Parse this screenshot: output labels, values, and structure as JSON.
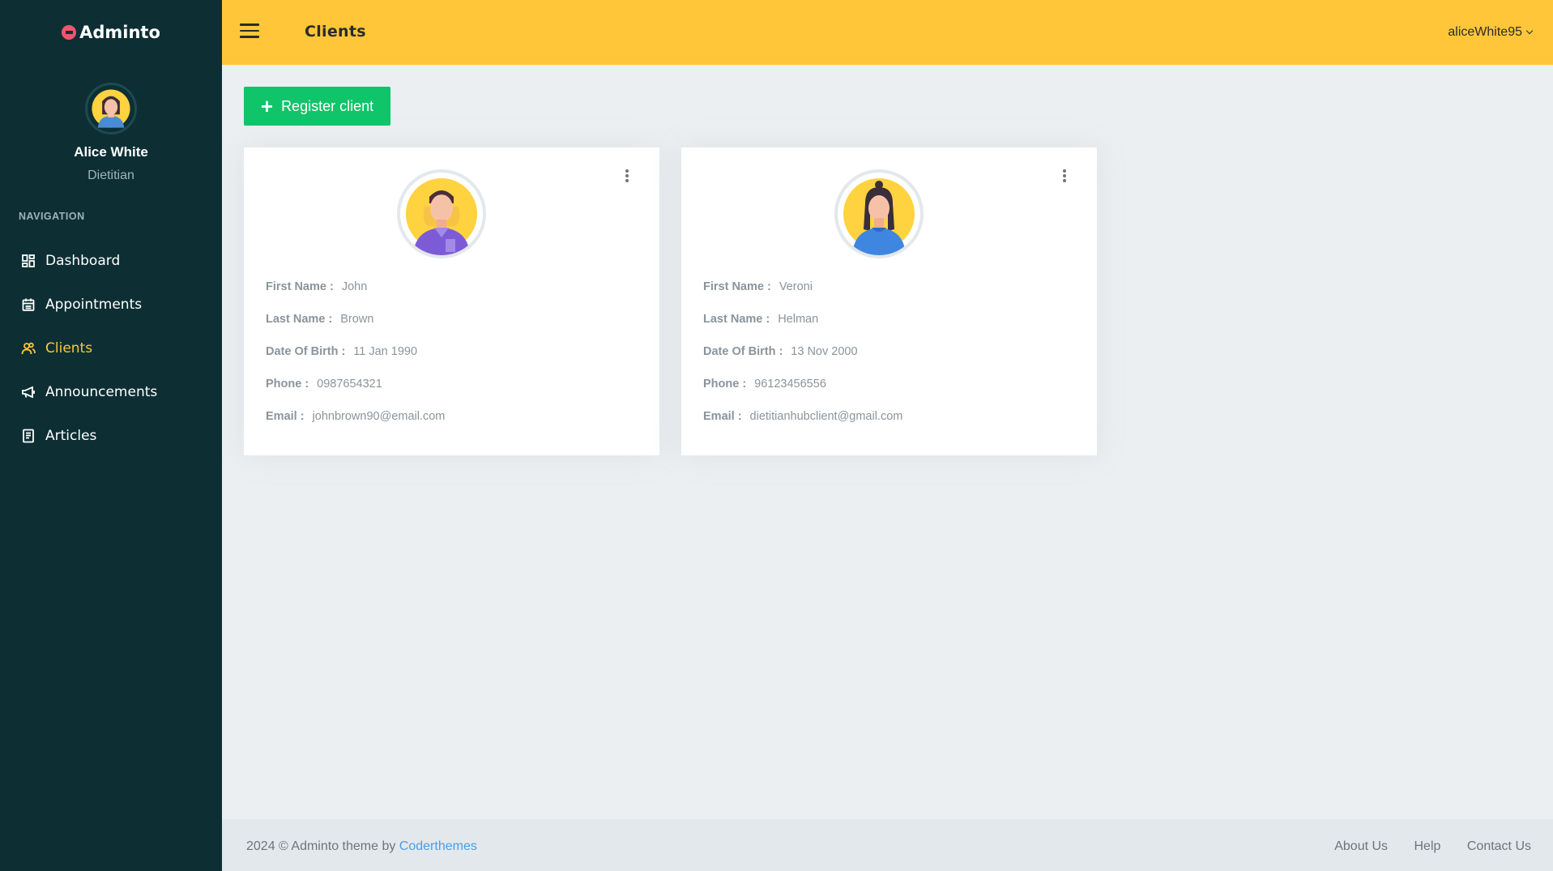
{
  "brand": {
    "name": "Adminto"
  },
  "profile": {
    "name": "Alice White",
    "role": "Dietitian"
  },
  "sidebar": {
    "heading": "NAVIGATION",
    "items": [
      {
        "label": "Dashboard",
        "icon": "dashboard-icon"
      },
      {
        "label": "Appointments",
        "icon": "calendar-icon"
      },
      {
        "label": "Clients",
        "icon": "users-icon",
        "active": true
      },
      {
        "label": "Announcements",
        "icon": "megaphone-icon"
      },
      {
        "label": "Articles",
        "icon": "article-icon"
      }
    ]
  },
  "topbar": {
    "title": "Clients",
    "username": "aliceWhite95"
  },
  "actions": {
    "register_label": "Register client"
  },
  "labels": {
    "first_name": "First Name :",
    "last_name": "Last Name :",
    "dob": "Date Of Birth :",
    "phone": "Phone :",
    "email": "Email :"
  },
  "clients": [
    {
      "first_name": "John",
      "last_name": "Brown",
      "dob": "11 Jan 1990",
      "phone": "0987654321",
      "email": "johnbrown90@email.com"
    },
    {
      "first_name": "Veroni",
      "last_name": "Helman",
      "dob": "13 Nov 2000",
      "phone": "96123456556",
      "email": "dietitianhubclient@gmail.com"
    }
  ],
  "footer": {
    "copyright": "2024 © Adminto theme by",
    "author": "Coderthemes",
    "links": [
      "About Us",
      "Help",
      "Contact Us"
    ]
  },
  "colors": {
    "sidebar": "#0d2f34",
    "topbar": "#ffc639",
    "accent_active": "#ffc639",
    "success": "#10c469",
    "link": "#4a9dea"
  }
}
